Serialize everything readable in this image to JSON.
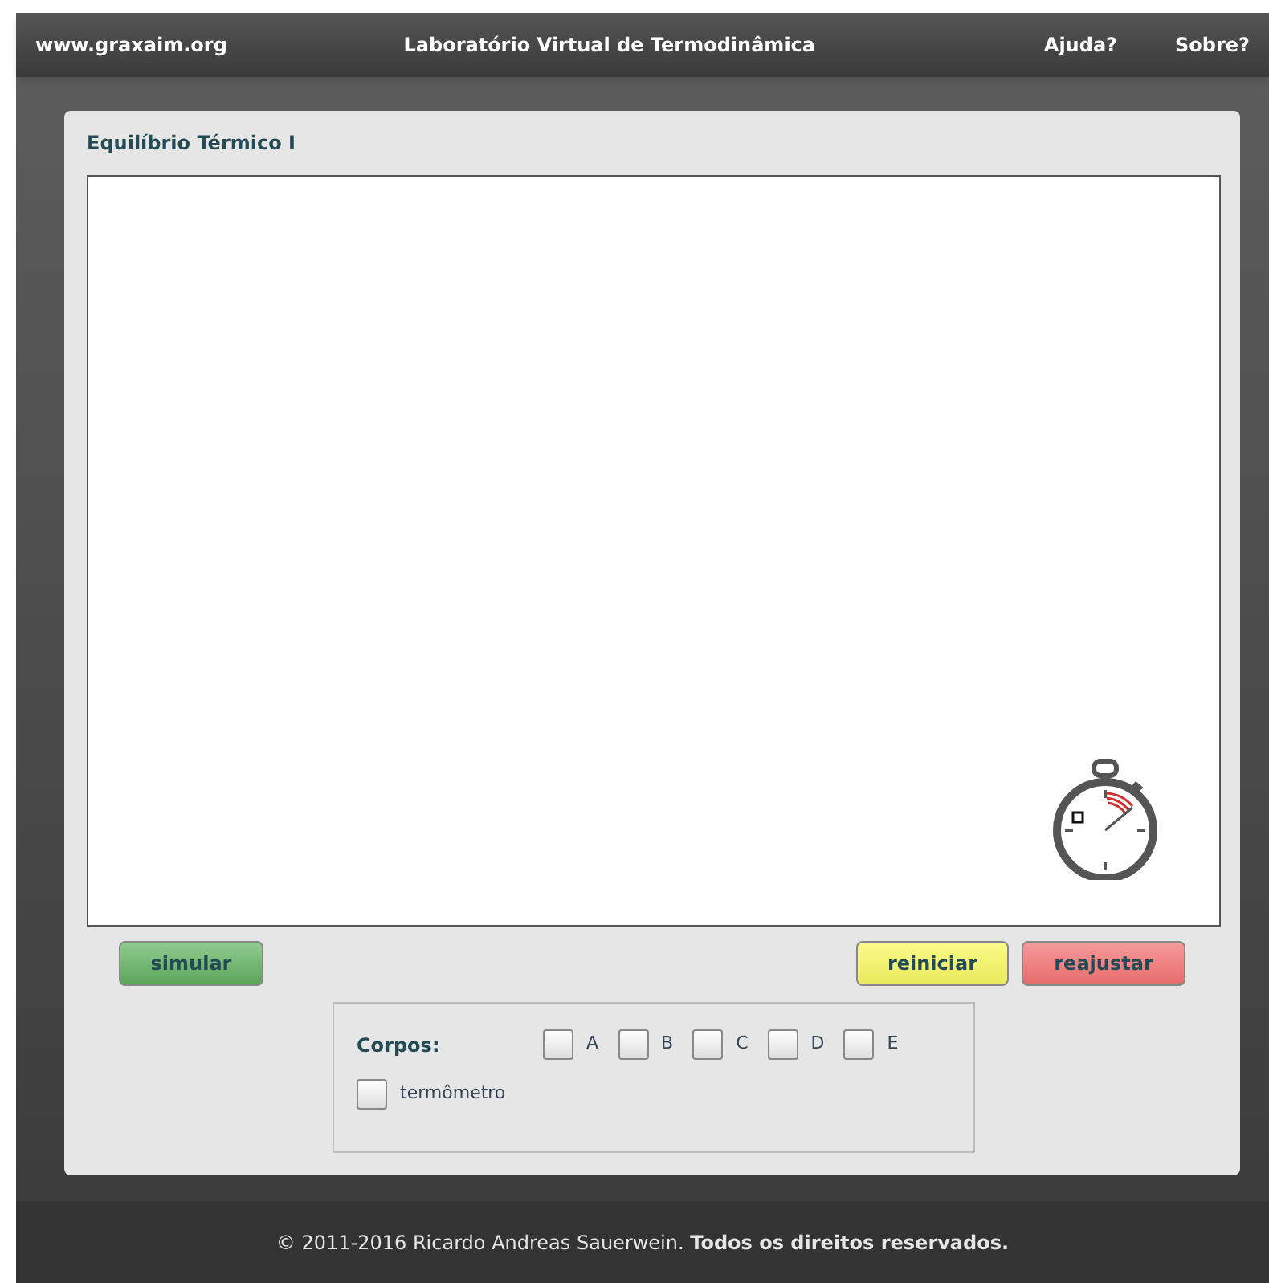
{
  "header": {
    "site": "www.graxaim.org",
    "title": "Laboratório Virtual de Termodinâmica",
    "links": [
      "Ajuda?",
      "Sobre?"
    ]
  },
  "panel": {
    "title": "Equilíbrio Térmico I"
  },
  "buttons": [
    {
      "label": "simular",
      "kind": "green"
    },
    {
      "label": "reiniciar",
      "kind": "yellow"
    },
    {
      "label": "reajustar",
      "kind": "red"
    }
  ],
  "options": {
    "label": "Corpos:",
    "bodies": [
      {
        "label": "A",
        "checked": false
      },
      {
        "label": "B",
        "checked": false
      },
      {
        "label": "C",
        "checked": false
      },
      {
        "label": "D",
        "checked": false
      },
      {
        "label": "E",
        "checked": false
      }
    ],
    "thermometer": {
      "label": "termômetro",
      "checked": false
    }
  },
  "footer": "© 2011-2016 Ricardo Andreas Sauerwein. **Todos os direitos reservados.**"
}
